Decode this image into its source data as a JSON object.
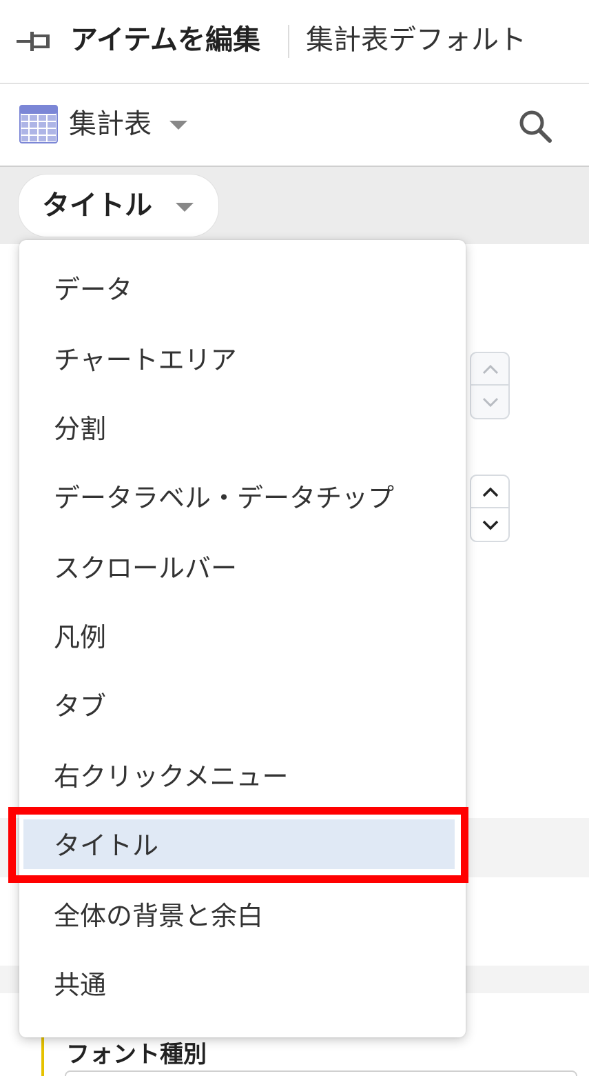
{
  "header": {
    "title": "アイテムを編集",
    "subtitle": "集計表デフォルト",
    "pin_icon": "pin-icon"
  },
  "toolbar": {
    "type_label": "集計表",
    "type_icon": "table-grid-icon",
    "search_icon": "search-icon"
  },
  "section_select": {
    "label": "タイトル"
  },
  "menu": {
    "selected_index": 8,
    "items": [
      {
        "label": "データ"
      },
      {
        "label": "チャートエリア"
      },
      {
        "label": "分割"
      },
      {
        "label": "データラベル・データチップ"
      },
      {
        "label": "スクロールバー"
      },
      {
        "label": "凡例"
      },
      {
        "label": "タブ"
      },
      {
        "label": "右クリックメニュー"
      },
      {
        "label": "タイトル"
      },
      {
        "label": "全体の背景と余白"
      },
      {
        "label": "共通"
      }
    ]
  },
  "background": {
    "font_section_label": "フォント種別"
  },
  "colors": {
    "selected_bg": "#e0e9f5",
    "highlight": "#ff0000",
    "table_icon": "#7b86d6",
    "section_accent": "#e6c200"
  }
}
